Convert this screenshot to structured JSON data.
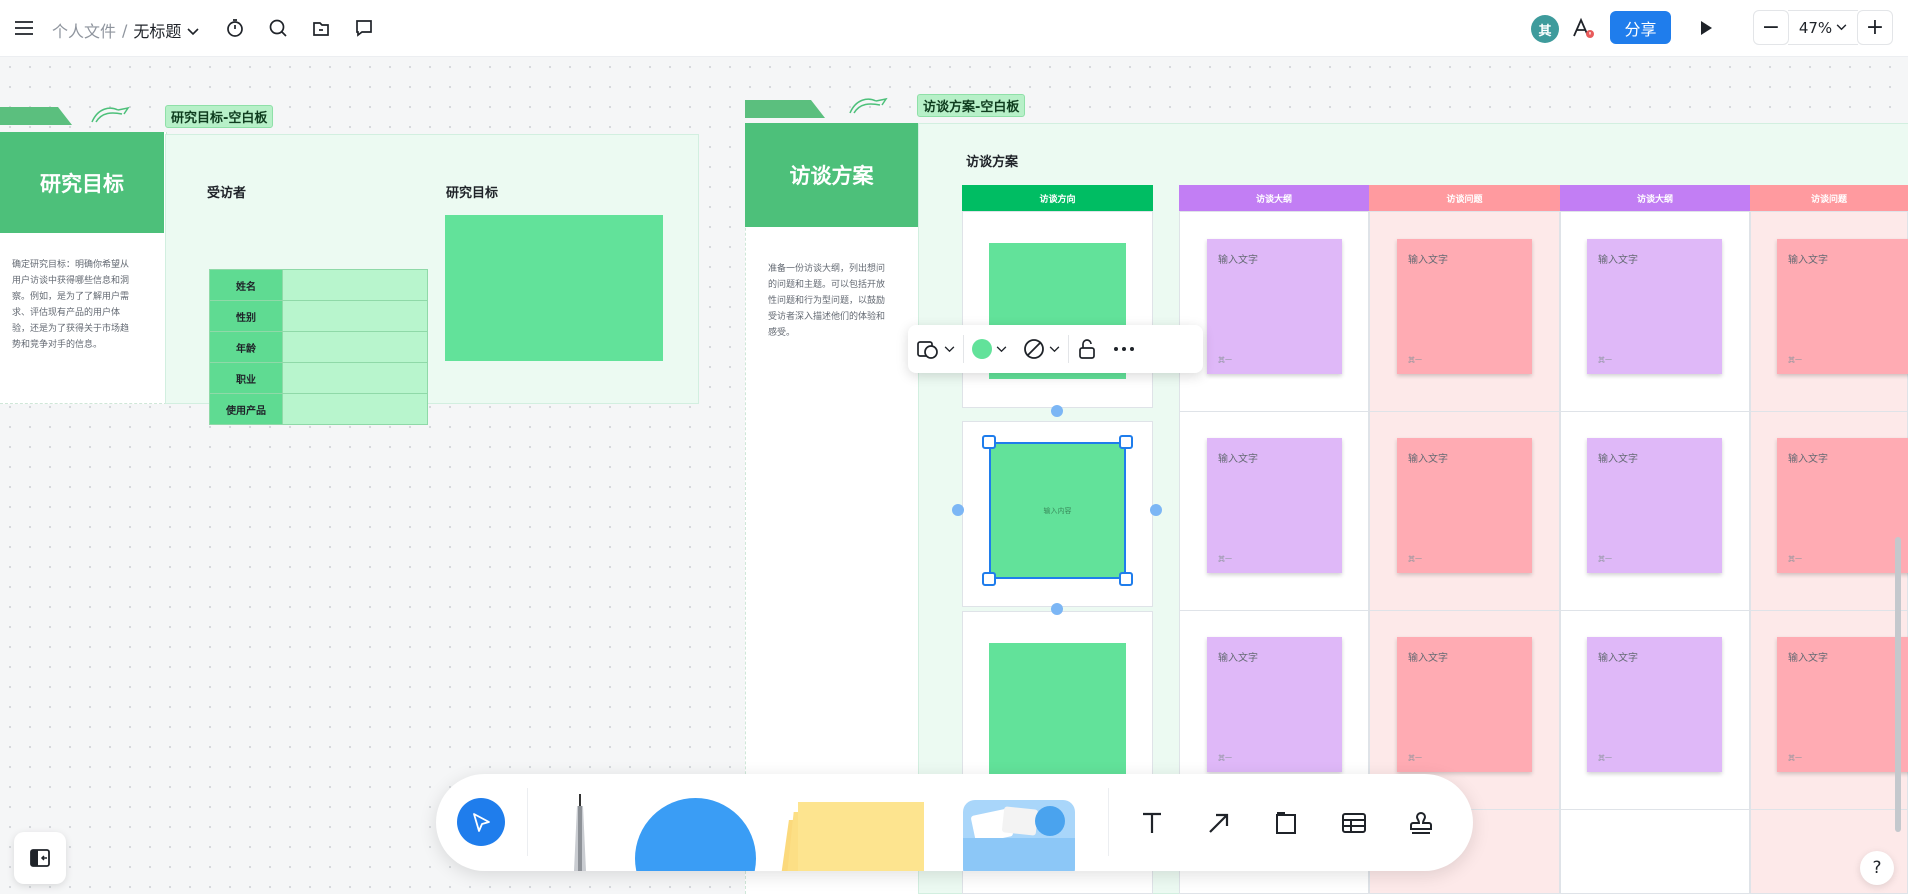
{
  "topbar": {
    "breadcrumb_parent": "个人文件",
    "breadcrumb_sep": "/",
    "doc_title": "无标题",
    "avatar_initial": "其",
    "share_label": "分享",
    "zoom_level": "47%",
    "zoom_out": "−",
    "zoom_in": "+"
  },
  "research_frame": {
    "tag": "研究目标-空白板",
    "title": "研究目标",
    "description": "确定研究目标：明确你希望从用户访谈中获得哪些信息和洞察。例如，是为了了解用户需求、评估现有产品的用户体验，还是为了获得关于市场趋势和竞争对手的信息。",
    "interviewee_title": "受访者",
    "goal_title": "研究目标",
    "rows": [
      "姓名",
      "性别",
      "年龄",
      "职业",
      "使用产品"
    ]
  },
  "interview_frame": {
    "tag": "访谈方案-空白板",
    "title": "访谈方案",
    "description": "准备一份访谈大纲，列出想问的问题和主题。可以包括开放性问题和行为型问题，以鼓励受访者深入描述他们的体验和感受。",
    "board_title": "访谈方案",
    "columns": [
      "访谈方向",
      "访谈大纲",
      "访谈问题",
      "访谈大纲",
      "访谈问题"
    ],
    "sticky_text": "输入文字",
    "sticky_author": "其一",
    "selected_placeholder": "输入内容"
  },
  "colors": {
    "accent": "#1f7dec",
    "green": "#4dc07a",
    "green_sticky": "#62e29a",
    "purple_head": "#c27ef4",
    "pink_head": "#ff9a9f",
    "purple_sticky": "#dfb8f8",
    "pink_sticky": "#ffabb3"
  },
  "help_label": "?"
}
